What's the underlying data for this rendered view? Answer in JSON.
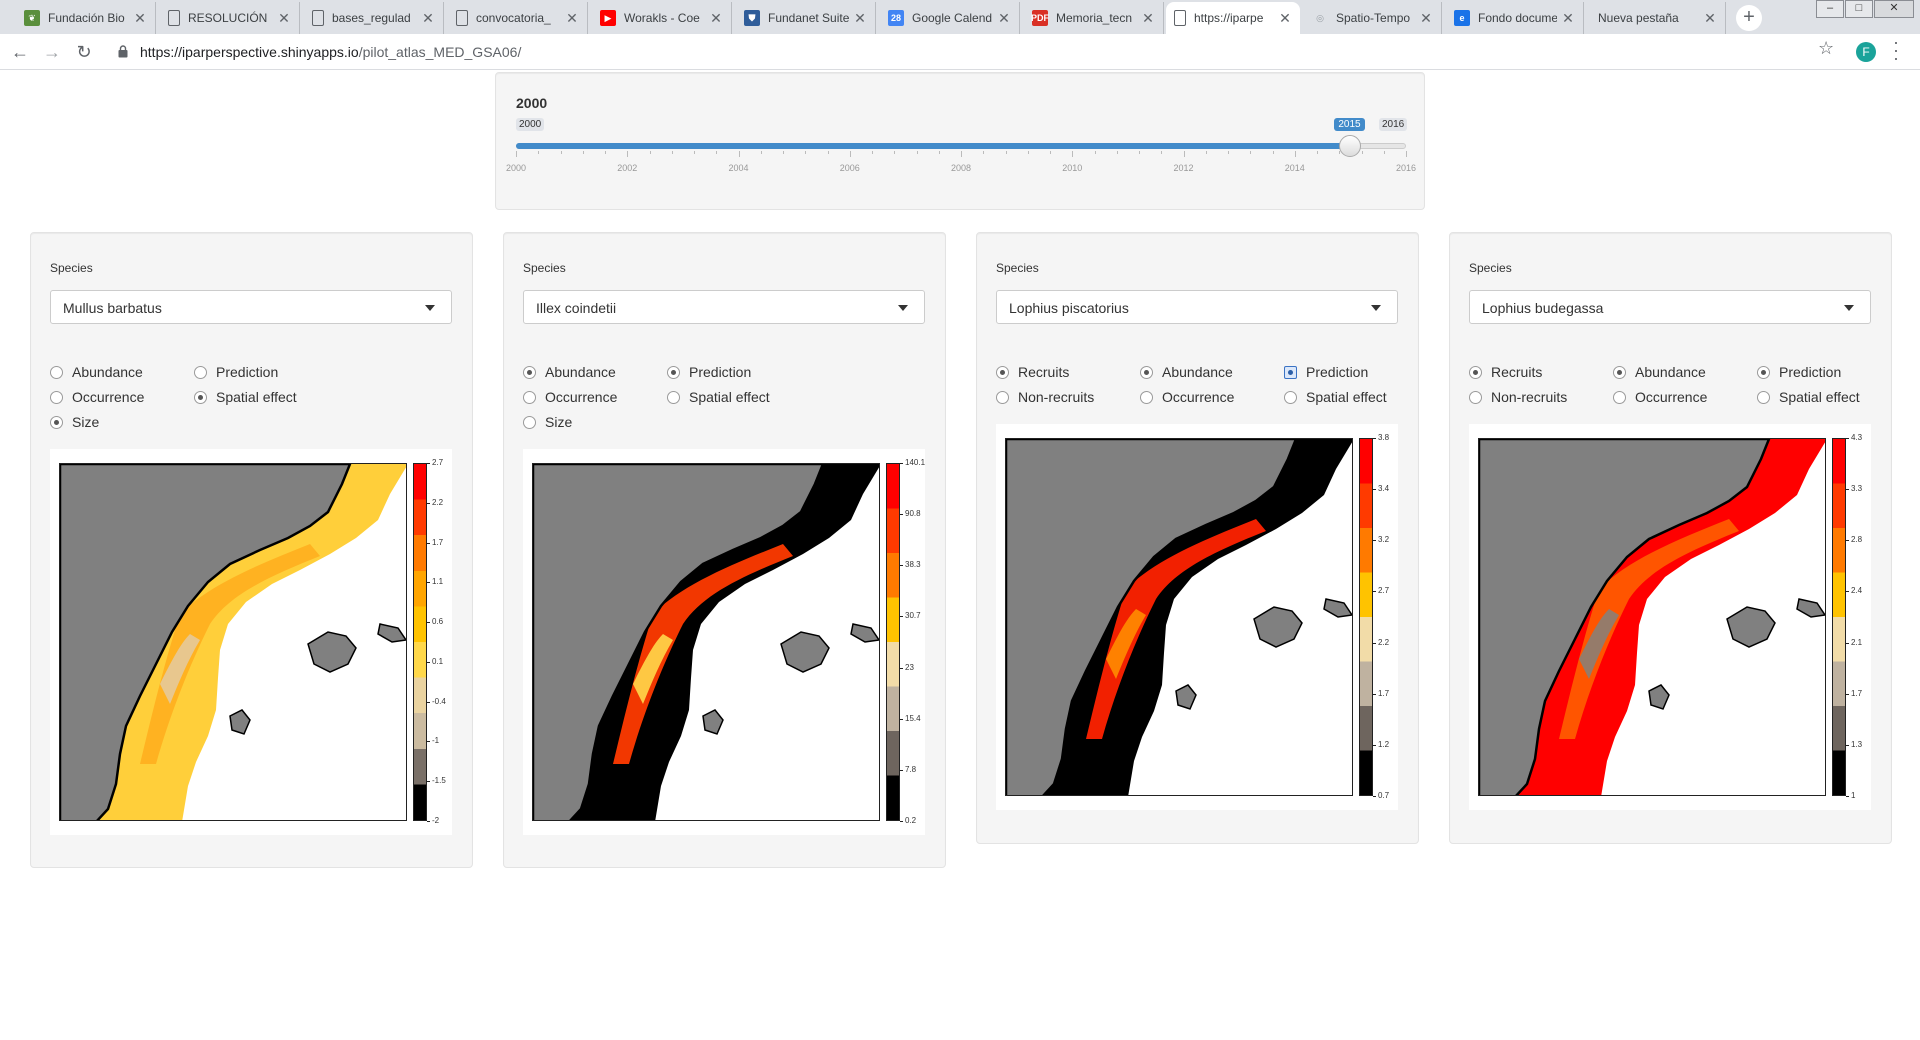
{
  "browser": {
    "tabs": [
      {
        "title": "Fundación Bio",
        "favicon": "leaf-icon",
        "color": "#5a8f3c"
      },
      {
        "title": "RESOLUCIÓN",
        "favicon": "document-icon",
        "color": "#5f6368"
      },
      {
        "title": "bases_regulad",
        "favicon": "document-icon",
        "color": "#5f6368"
      },
      {
        "title": "convocatoria_",
        "favicon": "document-icon",
        "color": "#5f6368"
      },
      {
        "title": "Worakls - Coe",
        "favicon": "youtube-icon",
        "color": "#ff0000"
      },
      {
        "title": "Fundanet Suite",
        "favicon": "shield-icon",
        "color": "#2f5d9a"
      },
      {
        "title": "Google Calend",
        "favicon": "calendar-icon",
        "color": "#4285f4"
      },
      {
        "title": "Memoria_tecn",
        "favicon": "pdf-icon",
        "color": "#d93025"
      },
      {
        "title": "https://iparpe",
        "favicon": "document-icon",
        "color": "#5f6368",
        "active": true
      },
      {
        "title": "Spatio-Tempo",
        "favicon": "globe-icon",
        "color": "#9aa0a6"
      },
      {
        "title": "Fondo docume",
        "favicon": "edge-icon",
        "color": "#1a73e8"
      },
      {
        "title": "Nueva pestaña",
        "favicon": "",
        "color": "#5f6368"
      }
    ],
    "url_host": "https://iparperspective.shinyapps.io",
    "url_path": "/pilot_atlas_MED_GSA06/",
    "profile_initial": "F"
  },
  "slider": {
    "label": "2000",
    "min": "2000",
    "max": "2016",
    "value": "2015",
    "value_fraction": 0.9375,
    "ticks": [
      "2000",
      "2002",
      "2004",
      "2006",
      "2008",
      "2010",
      "2012",
      "2014",
      "2016"
    ]
  },
  "panels": [
    {
      "label": "Species",
      "species": "Mullus barbatus",
      "options": [
        {
          "label": "Abundance",
          "checked": false
        },
        {
          "label": "Prediction",
          "checked": false
        },
        {
          "label": "Occurrence",
          "checked": false
        },
        {
          "label": "Spatial effect",
          "checked": true
        },
        {
          "label": "Size",
          "checked": true
        }
      ],
      "legend": [
        "2.7",
        "2.2",
        "1.7",
        "1.1",
        "0.6",
        "0.1",
        "-0.4",
        "-1",
        "-1.5",
        "-2"
      ]
    },
    {
      "label": "Species",
      "species": "Illex coindetii",
      "options": [
        {
          "label": "Abundance",
          "checked": true
        },
        {
          "label": "Prediction",
          "checked": true
        },
        {
          "label": "Occurrence",
          "checked": false
        },
        {
          "label": "Spatial effect",
          "checked": false
        },
        {
          "label": "Size",
          "checked": false
        }
      ],
      "legend": [
        "140.1",
        "90.8",
        "38.3",
        "30.7",
        "23",
        "15.4",
        "7.8",
        "0.2"
      ]
    },
    {
      "label": "Species",
      "species": "Lophius piscatorius",
      "options": [
        {
          "label": "Recruits",
          "checked": true
        },
        {
          "label": "Abundance",
          "checked": true
        },
        {
          "label": "Prediction",
          "checked": true
        },
        {
          "label": "Non-recruits",
          "checked": false
        },
        {
          "label": "Occurrence",
          "checked": false
        },
        {
          "label": "Spatial effect",
          "checked": false
        }
      ],
      "legend": [
        "3.8",
        "3.4",
        "3.2",
        "2.7",
        "2.2",
        "1.7",
        "1.2",
        "0.7"
      ]
    },
    {
      "label": "Species",
      "species": "Lophius budegassa",
      "options": [
        {
          "label": "Recruits",
          "checked": true
        },
        {
          "label": "Abundance",
          "checked": true
        },
        {
          "label": "Prediction",
          "checked": true
        },
        {
          "label": "Non-recruits",
          "checked": false
        },
        {
          "label": "Occurrence",
          "checked": false
        },
        {
          "label": "Spatial effect",
          "checked": false
        }
      ],
      "legend": [
        "4.3",
        "3.3",
        "2.8",
        "2.4",
        "2.1",
        "1.7",
        "1.3",
        "1"
      ]
    }
  ],
  "colors": {
    "land": "#808080",
    "sea": "#ffffff",
    "accent": "#428bca",
    "scale_high": "#ff0000",
    "scale_mid": "#ffc300",
    "scale_low": "#000000"
  }
}
